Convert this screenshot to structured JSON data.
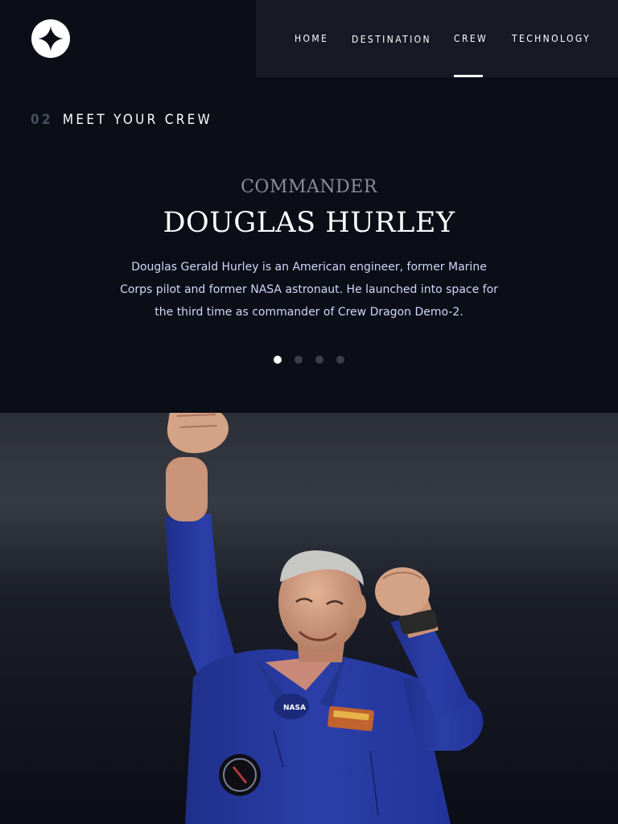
{
  "nav": {
    "items": [
      {
        "label": "HOME",
        "active": false
      },
      {
        "label": "DESTINATION",
        "active": false
      },
      {
        "label": "CREW",
        "active": true
      },
      {
        "label": "TECHNOLOGY",
        "active": false
      }
    ]
  },
  "section": {
    "number": "02",
    "title": "MEET YOUR CREW"
  },
  "crew": {
    "role": "COMMANDER",
    "name": "DOUGLAS HURLEY",
    "bio": "Douglas Gerald Hurley is an American engineer, former Marine Corps pilot and former NASA astronaut. He launched into space for the third time as commander of Crew Dragon Demo-2."
  },
  "pager": {
    "count": 4,
    "active_index": 0
  },
  "image": {
    "patch_text": "NASA"
  },
  "colors": {
    "background": "#0b0d17",
    "navbar": "#171a25",
    "accent_text": "#d0d6f9",
    "inactive_dot": "#3c3e49",
    "suit_blue": "#2b3fa8"
  }
}
